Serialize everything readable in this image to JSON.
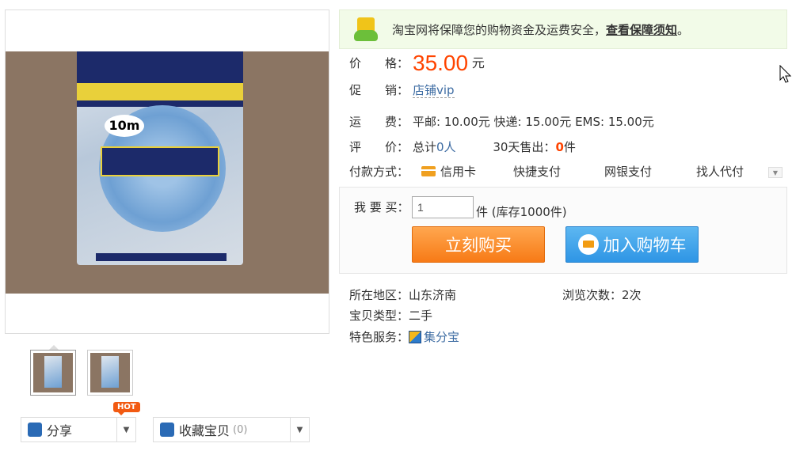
{
  "gallery": {
    "thumbnails": [
      {
        "alt": "product-thumb-1"
      },
      {
        "alt": "product-thumb-2"
      }
    ],
    "hot_badge": "HOT",
    "share_label": "分享",
    "favorite_label": "收藏宝贝",
    "favorite_count": "(0)"
  },
  "notice": {
    "text": "淘宝网将保障您的购物资金及运费安全，",
    "link": "查看保障须知",
    "tail": "。"
  },
  "info": {
    "price_label": "价　　格：",
    "price": "35.00",
    "price_unit": "元",
    "promo_label": "促　　销：",
    "promo": "店铺vip",
    "shipping_label": "运　　费：",
    "shipping": "平邮: 10.00元 快递: 15.00元 EMS: 15.00元",
    "rating_label": "评　　价：",
    "rating_prefix": "总计",
    "rating_count": "0人",
    "sales_prefix": "30天售出：",
    "sales_count": "0",
    "sales_unit": "件",
    "payment_label": "付款方式：",
    "payment_methods": [
      "信用卡",
      "快捷支付",
      "网银支付",
      "找人代付"
    ]
  },
  "buy": {
    "qty_label": "我 要 买：",
    "qty_value": "1",
    "stock": "件 (库存1000件)",
    "buy_now": "立刻购买",
    "add_cart": "加入购物车"
  },
  "meta": {
    "region_label": "所在地区：",
    "region": "山东济南",
    "views_label": "浏览次数：",
    "views": "2次",
    "type_label": "宝贝类型：",
    "type": "二手",
    "service_label": "特色服务：",
    "service": "集分宝"
  },
  "colors": {
    "price": "#ff4400",
    "buy": "#f77a16",
    "cart": "#2e95e5",
    "link": "#3c6ba2"
  }
}
